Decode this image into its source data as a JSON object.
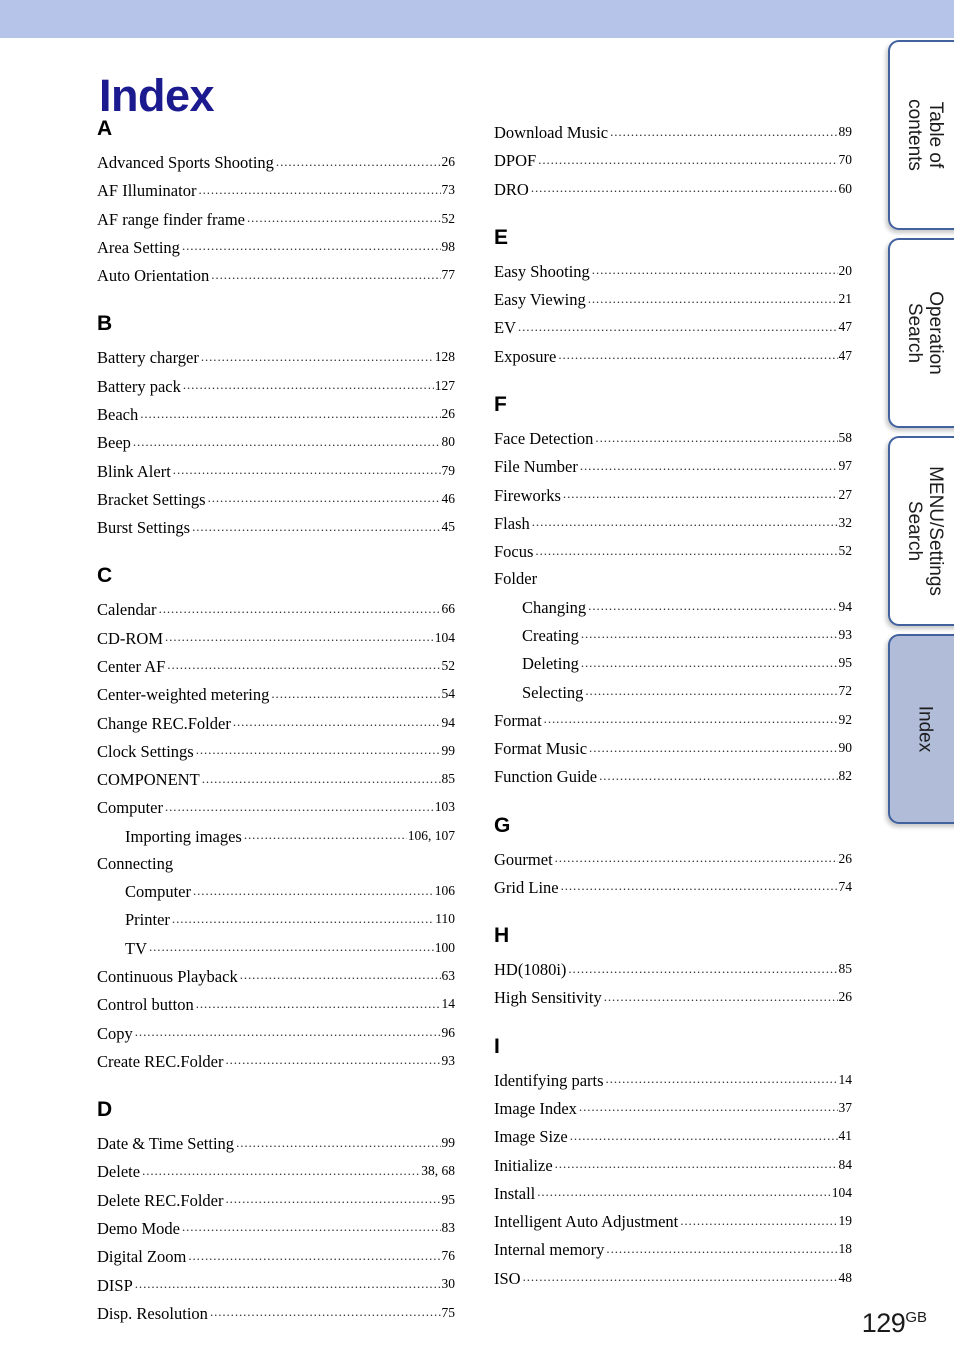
{
  "page": {
    "title": "Index",
    "number": "129",
    "number_suffix": "GB",
    "title_color": "#1b1b8f",
    "band_color": "#b5c4e8"
  },
  "tabs": [
    {
      "id": "toc",
      "line1": "Table of",
      "line2": "contents",
      "active": false
    },
    {
      "id": "op",
      "line1": "Operation",
      "line2": "Search",
      "active": false
    },
    {
      "id": "menu",
      "line1": "MENU/Settings",
      "line2": "Search",
      "active": false
    },
    {
      "id": "index",
      "line1": "Index",
      "line2": "",
      "active": true
    }
  ],
  "columns": [
    {
      "sections": [
        {
          "letter": "A",
          "entries": [
            {
              "term": "Advanced Sports Shooting",
              "page": "26",
              "sub": false
            },
            {
              "term": "AF Illuminator",
              "page": "73",
              "sub": false
            },
            {
              "term": "AF range finder frame",
              "page": "52",
              "sub": false
            },
            {
              "term": "Area Setting",
              "page": "98",
              "sub": false
            },
            {
              "term": "Auto Orientation",
              "page": "77",
              "sub": false
            }
          ]
        },
        {
          "letter": "B",
          "entries": [
            {
              "term": "Battery charger",
              "page": "128",
              "sub": false
            },
            {
              "term": "Battery pack",
              "page": "127",
              "sub": false
            },
            {
              "term": "Beach",
              "page": "26",
              "sub": false
            },
            {
              "term": "Beep",
              "page": "80",
              "sub": false
            },
            {
              "term": "Blink Alert",
              "page": "79",
              "sub": false
            },
            {
              "term": "Bracket Settings",
              "page": "46",
              "sub": false
            },
            {
              "term": "Burst Settings",
              "page": "45",
              "sub": false
            }
          ]
        },
        {
          "letter": "C",
          "entries": [
            {
              "term": "Calendar",
              "page": "66",
              "sub": false
            },
            {
              "term": "CD-ROM",
              "page": "104",
              "sub": false
            },
            {
              "term": "Center AF",
              "page": "52",
              "sub": false
            },
            {
              "term": "Center-weighted metering",
              "page": "54",
              "sub": false
            },
            {
              "term": "Change REC.Folder",
              "page": "94",
              "sub": false
            },
            {
              "term": "Clock Settings",
              "page": "99",
              "sub": false
            },
            {
              "term": "COMPONENT",
              "page": "85",
              "sub": false
            },
            {
              "term": "Computer",
              "page": "103",
              "sub": false
            },
            {
              "term": "Importing images",
              "page": "106, 107",
              "sub": true
            },
            {
              "term": "Connecting",
              "page": "",
              "sub": false,
              "noleader": true
            },
            {
              "term": "Computer",
              "page": "106",
              "sub": true
            },
            {
              "term": "Printer",
              "page": "110",
              "sub": true
            },
            {
              "term": "TV",
              "page": "100",
              "sub": true
            },
            {
              "term": "Continuous Playback",
              "page": "63",
              "sub": false
            },
            {
              "term": "Control button",
              "page": "14",
              "sub": false
            },
            {
              "term": "Copy",
              "page": "96",
              "sub": false
            },
            {
              "term": "Create REC.Folder",
              "page": "93",
              "sub": false
            }
          ]
        },
        {
          "letter": "D",
          "entries": [
            {
              "term": "Date & Time Setting",
              "page": "99",
              "sub": false
            },
            {
              "term": "Delete",
              "page": "38, 68",
              "sub": false
            },
            {
              "term": "Delete REC.Folder",
              "page": "95",
              "sub": false
            },
            {
              "term": "Demo Mode",
              "page": "83",
              "sub": false
            },
            {
              "term": "Digital Zoom",
              "page": "76",
              "sub": false
            },
            {
              "term": "DISP",
              "page": "30",
              "sub": false
            },
            {
              "term": "Disp. Resolution",
              "page": "75",
              "sub": false
            }
          ]
        }
      ]
    },
    {
      "sections": [
        {
          "letter": "",
          "entries": [
            {
              "term": "Download Music",
              "page": "89",
              "sub": false
            },
            {
              "term": "DPOF",
              "page": "70",
              "sub": false
            },
            {
              "term": "DRO",
              "page": "60",
              "sub": false
            }
          ]
        },
        {
          "letter": "E",
          "entries": [
            {
              "term": "Easy Shooting",
              "page": "20",
              "sub": false
            },
            {
              "term": "Easy Viewing",
              "page": "21",
              "sub": false
            },
            {
              "term": "EV",
              "page": "47",
              "sub": false
            },
            {
              "term": "Exposure",
              "page": "47",
              "sub": false
            }
          ]
        },
        {
          "letter": "F",
          "entries": [
            {
              "term": "Face Detection",
              "page": "58",
              "sub": false
            },
            {
              "term": "File Number",
              "page": "97",
              "sub": false
            },
            {
              "term": "Fireworks",
              "page": "27",
              "sub": false
            },
            {
              "term": "Flash",
              "page": "32",
              "sub": false
            },
            {
              "term": "Focus",
              "page": "52",
              "sub": false
            },
            {
              "term": "Folder",
              "page": "",
              "sub": false,
              "noleader": true
            },
            {
              "term": "Changing",
              "page": "94",
              "sub": true
            },
            {
              "term": "Creating",
              "page": "93",
              "sub": true
            },
            {
              "term": "Deleting",
              "page": "95",
              "sub": true
            },
            {
              "term": "Selecting",
              "page": "72",
              "sub": true
            },
            {
              "term": "Format",
              "page": "92",
              "sub": false
            },
            {
              "term": "Format Music",
              "page": "90",
              "sub": false
            },
            {
              "term": "Function Guide",
              "page": "82",
              "sub": false
            }
          ]
        },
        {
          "letter": "G",
          "entries": [
            {
              "term": "Gourmet",
              "page": "26",
              "sub": false
            },
            {
              "term": "Grid Line",
              "page": "74",
              "sub": false
            }
          ]
        },
        {
          "letter": "H",
          "entries": [
            {
              "term": "HD(1080i)",
              "page": "85",
              "sub": false
            },
            {
              "term": "High Sensitivity",
              "page": "26",
              "sub": false
            }
          ]
        },
        {
          "letter": "I",
          "entries": [
            {
              "term": "Identifying parts",
              "page": "14",
              "sub": false
            },
            {
              "term": "Image Index",
              "page": "37",
              "sub": false
            },
            {
              "term": "Image Size",
              "page": "41",
              "sub": false
            },
            {
              "term": "Initialize",
              "page": "84",
              "sub": false
            },
            {
              "term": "Install",
              "page": "104",
              "sub": false
            },
            {
              "term": "Intelligent Auto Adjustment",
              "page": "19",
              "sub": false
            },
            {
              "term": "Internal memory",
              "page": "18",
              "sub": false
            },
            {
              "term": "ISO",
              "page": "48",
              "sub": false
            }
          ]
        }
      ]
    }
  ]
}
